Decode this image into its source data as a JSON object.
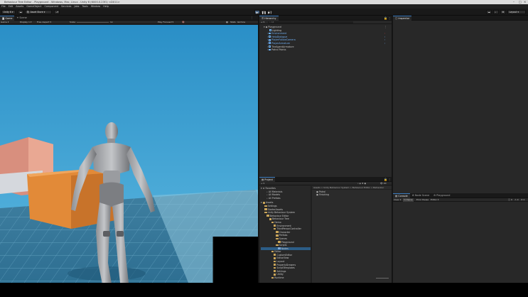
{
  "window": {
    "title": "Behaviour Tree Editor - Playground - Windows, Mac, Linux - Unity 6 (6000.0.23f1) <DX11>"
  },
  "menu": [
    "File",
    "Edit",
    "Assets",
    "GameObject",
    "Component",
    "Services",
    "Jobs",
    "Tools",
    "Window",
    "Help"
  ],
  "toolbar": {
    "account": "Unity 6",
    "asset_store": "Asset Store",
    "layout": "Layout"
  },
  "scene_tabs": {
    "game": "Game",
    "scene": "Scene"
  },
  "game_bar": {
    "display": "Display 1",
    "aspect": "Free Aspect",
    "scale_label": "Scale",
    "scale_value": "1x",
    "play_mode": "Play Focused",
    "stats": "Stats",
    "gizmos": "Gizmos",
    "mode": "Game"
  },
  "hierarchy": {
    "tab": "Hierarchy",
    "search_placeholder": "All",
    "scene": "Playground",
    "items": [
      {
        "label": "Lighting",
        "blue": false,
        "indent": 1
      },
      {
        "label": "Environment",
        "blue": true,
        "indent": 1
      },
      {
        "label": "HelpDialogue",
        "blue": true,
        "indent": 1
      },
      {
        "label": "PlayerFollowCamera",
        "blue": true,
        "indent": 1
      },
      {
        "label": "PlayerArmature",
        "blue": true,
        "indent": 1
      },
      {
        "label": "TheAgentArmature",
        "blue": false,
        "indent": 1
      },
      {
        "label": "Patrol Points",
        "blue": false,
        "indent": 1
      }
    ]
  },
  "project": {
    "tab": "Project",
    "breadcrumb": "Assets > Unity Behaviour System > Behaviour Editor > Behaviour",
    "favorites_label": "Favorites",
    "favorites": [
      "All Materials",
      "All Models",
      "All Prefabs"
    ],
    "assets_label": "Assets",
    "tree": [
      {
        "label": "Settings",
        "indent": 1
      },
      {
        "label": "StarterAssets",
        "indent": 1
      },
      {
        "label": "Unity Behaviour System",
        "indent": 1
      },
      {
        "label": "Behaviour Editor",
        "indent": 2
      },
      {
        "label": "Behaviour Tree",
        "indent": 3
      },
      {
        "label": "Demo",
        "indent": 4
      },
      {
        "label": "Environment",
        "indent": 5
      },
      {
        "label": "ThirdPersonController",
        "indent": 5
      },
      {
        "label": "Character",
        "indent": 6
      },
      {
        "label": "Prefabs",
        "indent": 6
      },
      {
        "label": "Scenes",
        "indent": 6
      },
      {
        "label": "Playground",
        "indent": 7
      },
      {
        "label": "Scripts",
        "indent": 6
      },
      {
        "label": "Nodes",
        "indent": 7,
        "selected": true
      },
      {
        "label": "Editor",
        "indent": 4
      },
      {
        "label": "CustomEditor",
        "indent": 5
      },
      {
        "label": "EditorView",
        "indent": 5
      },
      {
        "label": "Layout",
        "indent": 5
      },
      {
        "label": "PropertyDrawers",
        "indent": 5
      },
      {
        "label": "ScriptTemplates",
        "indent": 5
      },
      {
        "label": "Settings",
        "indent": 5
      },
      {
        "label": "Utility",
        "indent": 5
      },
      {
        "label": "Runtime",
        "indent": 4
      }
    ],
    "files": [
      "Patrol",
      "Finishing"
    ],
    "count": "20"
  },
  "inspector": {
    "tab": "Inspector"
  },
  "console": {
    "tabs": [
      "Console",
      "Node Scene",
      "Playground"
    ],
    "clear": "Clear",
    "collapse": "Collapse",
    "error_pause": "Error Pause",
    "editor": "Editor",
    "counts": [
      "0",
      "0",
      "0"
    ]
  }
}
